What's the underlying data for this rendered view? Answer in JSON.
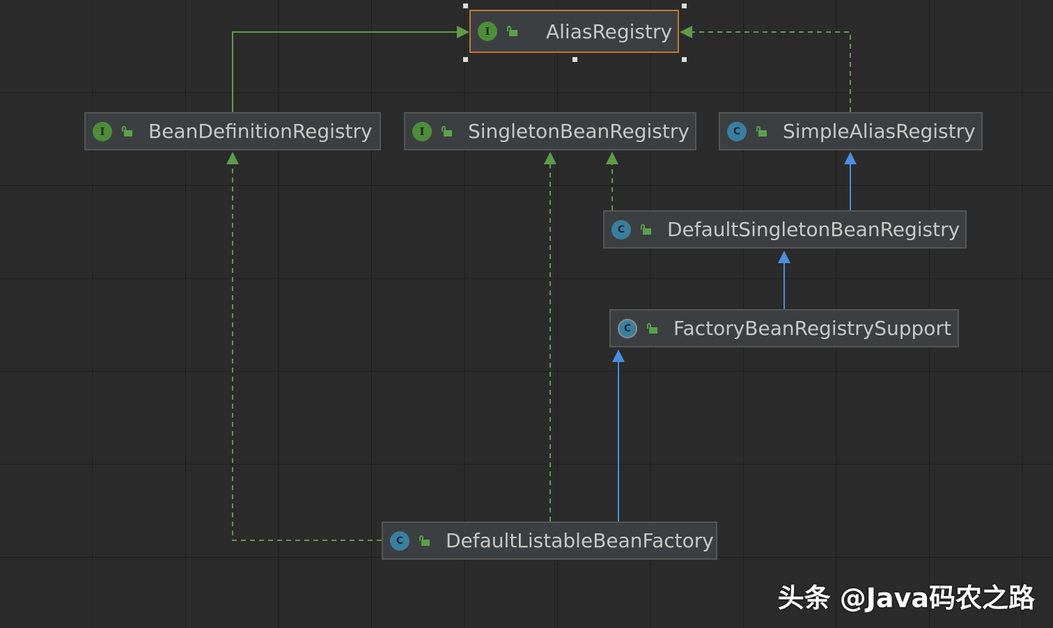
{
  "diagram": {
    "nodes": [
      {
        "id": "alias-registry",
        "label": "AliasRegistry",
        "kind": "interface",
        "badge": "I"
      },
      {
        "id": "bean-definition-registry",
        "label": "BeanDefinitionRegistry",
        "kind": "interface",
        "badge": "I"
      },
      {
        "id": "singleton-bean-registry",
        "label": "SingletonBeanRegistry",
        "kind": "interface",
        "badge": "I"
      },
      {
        "id": "simple-alias-registry",
        "label": "SimpleAliasRegistry",
        "kind": "class",
        "badge": "C"
      },
      {
        "id": "default-singleton-bean-registry",
        "label": "DefaultSingletonBeanRegistry",
        "kind": "class",
        "badge": "C"
      },
      {
        "id": "factory-bean-registry-support",
        "label": "FactoryBeanRegistrySupport",
        "kind": "abstract-class",
        "badge": "C"
      },
      {
        "id": "default-listable-bean-factory",
        "label": "DefaultListableBeanFactory",
        "kind": "class",
        "badge": "C"
      }
    ],
    "edges": [
      {
        "from": "bean-definition-registry",
        "to": "alias-registry",
        "type": "extends"
      },
      {
        "from": "simple-alias-registry",
        "to": "alias-registry",
        "type": "implements"
      },
      {
        "from": "default-singleton-bean-registry",
        "to": "singleton-bean-registry",
        "type": "implements"
      },
      {
        "from": "default-singleton-bean-registry",
        "to": "simple-alias-registry",
        "type": "extends"
      },
      {
        "from": "factory-bean-registry-support",
        "to": "default-singleton-bean-registry",
        "type": "extends"
      },
      {
        "from": "default-listable-bean-factory",
        "to": "factory-bean-registry-support",
        "type": "extends"
      },
      {
        "from": "default-listable-bean-factory",
        "to": "singleton-bean-registry",
        "type": "implements"
      },
      {
        "from": "default-listable-bean-factory",
        "to": "bean-definition-registry",
        "type": "implements"
      }
    ],
    "selected_node": "alias-registry"
  },
  "colors": {
    "background": "#2b2b2b",
    "interface_badge": "#4e8c3a",
    "class_badge": "#3a7fa0",
    "interface_edge": "#5e9c4a",
    "class_edge": "#4a8ee0",
    "selection_border": "#c57633"
  },
  "icons": {
    "interface_badge": "interface-icon",
    "class_badge": "class-icon",
    "abstract_badge": "abstract-class-icon",
    "visibility": "public-lock-icon"
  },
  "watermark": {
    "text": "头条 @Java码农之路"
  }
}
